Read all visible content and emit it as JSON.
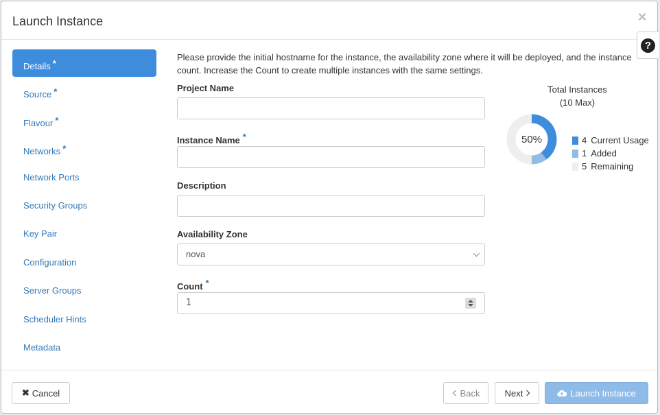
{
  "modal": {
    "title": "Launch Instance",
    "close_glyph": "×",
    "help_glyph": "?"
  },
  "nav": {
    "items": [
      {
        "label": "Details",
        "required": true,
        "active": true
      },
      {
        "label": "Source",
        "required": true
      },
      {
        "label": "Flavour",
        "required": true
      },
      {
        "label": "Networks",
        "required": true
      },
      {
        "label": "Network Ports",
        "required": false
      },
      {
        "label": "Security Groups",
        "required": false
      },
      {
        "label": "Key Pair",
        "required": false
      },
      {
        "label": "Configuration",
        "required": false
      },
      {
        "label": "Server Groups",
        "required": false
      },
      {
        "label": "Scheduler Hints",
        "required": false
      },
      {
        "label": "Metadata",
        "required": false
      }
    ],
    "required_mark": "*"
  },
  "details": {
    "help_text": "Please provide the initial hostname for the instance, the availability zone where it will be deployed, and the instance count. Increase the Count to create multiple instances with the same settings.",
    "project_name": {
      "label": "Project Name",
      "value": ""
    },
    "instance_name": {
      "label": "Instance Name",
      "value": ""
    },
    "description": {
      "label": "Description",
      "value": ""
    },
    "availability_zone": {
      "label": "Availability Zone",
      "selected": "nova"
    },
    "count": {
      "label": "Count",
      "value": "1"
    }
  },
  "instances_chart": {
    "title": "Total Instances",
    "subtitle": "(10 Max)",
    "percent_label": "50%",
    "max": 10,
    "legend": [
      {
        "value": "4",
        "label": "Current Usage",
        "amount": 4,
        "color": "#3e8ddd"
      },
      {
        "value": "1",
        "label": "Added",
        "amount": 1,
        "color": "#92bce6"
      },
      {
        "value": "5",
        "label": "Remaining",
        "amount": 5,
        "color": "#eeeeee"
      }
    ]
  },
  "footer": {
    "cancel_label": "Cancel",
    "back_label": "Back",
    "next_label": "Next",
    "launch_label": "Launch Instance"
  }
}
